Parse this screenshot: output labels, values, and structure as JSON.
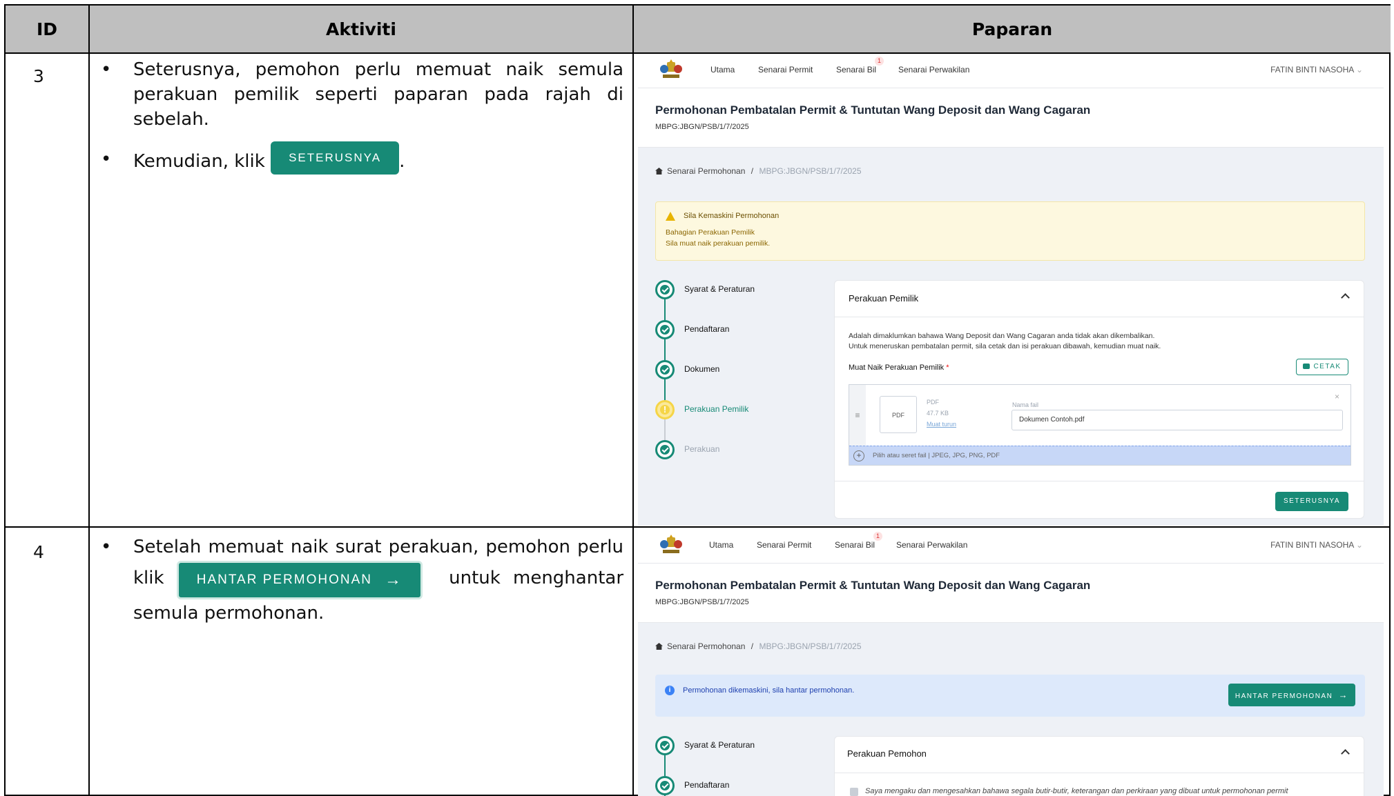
{
  "table": {
    "headers": {
      "id": "ID",
      "activity": "Aktiviti",
      "display": "Paparan"
    }
  },
  "rows": [
    {
      "id": "3",
      "bullets": [
        {
          "text": "Seterusnya, pemohon perlu memuat naik semula perakuan pemilik seperti paparan pada rajah di sebelah."
        },
        {
          "pre": "Kemudian, klik",
          "button": "SETERUSNYA",
          "post": "."
        }
      ]
    },
    {
      "id": "4",
      "bullets": [
        {
          "pre": "Setelah memuat naik surat perakuan, pemohon perlu klik",
          "button": "HANTAR PERMOHONAN",
          "post": "untuk menghantar semula permohonan."
        }
      ]
    }
  ],
  "screen": {
    "nav": {
      "items": [
        "Utama",
        "Senarai Permit",
        "Senarai Bil",
        "Senarai Perwakilan"
      ],
      "badge": "1",
      "user": "FATIN BINTI NASOHA"
    },
    "title": "Permohonan Pembatalan Permit & Tuntutan Wang Deposit dan Wang Cagaran",
    "ref": "MBPG:JBGN/PSB/1/7/2025",
    "breadcrumb": {
      "home": "Senarai Permohonan",
      "sep": "/",
      "current": "MBPG:JBGN/PSB/1/7/2025"
    },
    "steps": [
      "Syarat & Peraturan",
      "Pendaftaran",
      "Dokumen",
      "Perakuan Pemilik",
      "Perakuan"
    ]
  },
  "screen1": {
    "warning": {
      "title": "Sila Kemaskini Permohonan",
      "line1": "Bahagian Perakuan Pemilik",
      "line2": "Sila muat naik perakuan pemilik."
    },
    "card": {
      "title": "Perakuan Pemilik",
      "desc1": "Adalah dimaklumkan bahawa Wang Deposit dan Wang Cagaran anda tidak akan dikembalikan.",
      "desc2": "Untuk meneruskan pembatalan permit, sila cetak dan isi perakuan dibawah, kemudian muat naik.",
      "upload_label": "Muat Naik Perakuan Pemilik",
      "required": "*",
      "print_btn": "CETAK",
      "file_type": "PDF",
      "file_size": "47.7 KB",
      "download": "Muat turun",
      "filename_label": "Nama fail",
      "filename": "Dokumen Contoh.pdf",
      "dropzone": "Pilih atau seret fail | JPEG, JPG, PNG, PDF",
      "next_btn": "SETERUSNYA"
    }
  },
  "screen2": {
    "info": "Permohonan dikemaskini, sila hantar permohonan.",
    "submit_btn": "HANTAR PERMOHONAN",
    "card": {
      "title": "Perakuan Pemohon",
      "declaration": "Saya mengaku dan mengesahkan bahawa segala butir-butir, keterangan dan perkiraan yang dibuat untuk permohonan permit"
    }
  },
  "colors": {
    "accent": "#178a76",
    "header_bg": "#bfbfbf",
    "warn_bg": "#fdf8df",
    "info_bg": "#dde9fb"
  }
}
